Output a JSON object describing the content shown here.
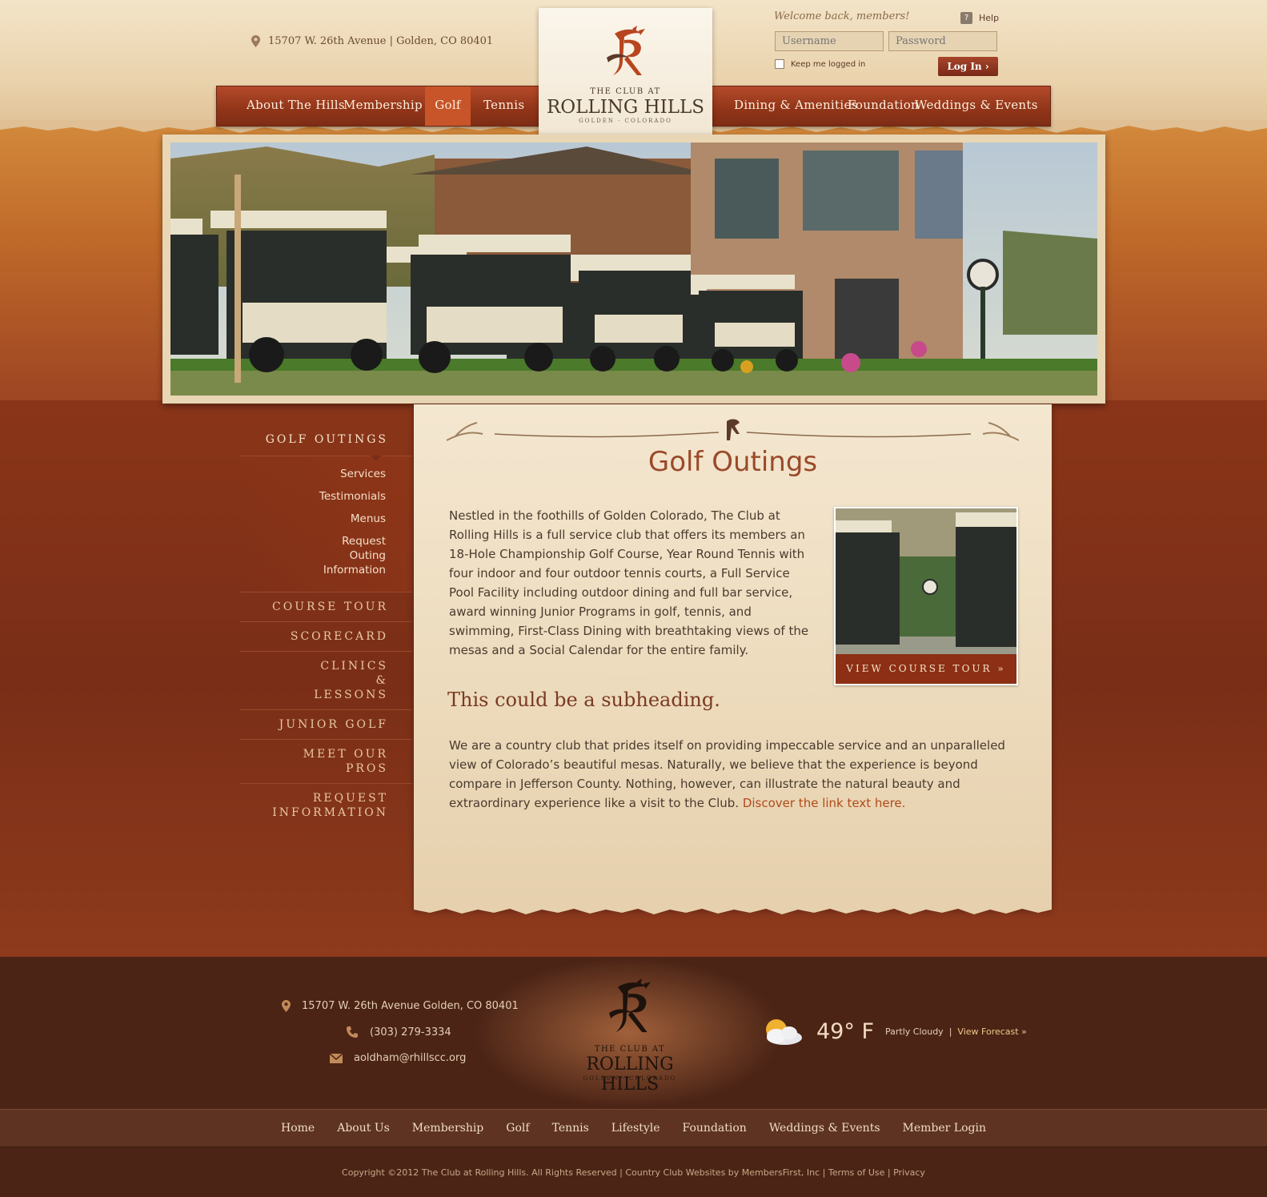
{
  "header": {
    "address": "15707 W. 26th Avenue  |  Golden, CO 80401",
    "welcome": "Welcome back, members!",
    "help": "Help",
    "username_placeholder": "Username",
    "password_placeholder": "Password",
    "keep_logged_in": "Keep me logged in",
    "login_button": "Log In"
  },
  "logo": {
    "small": "THE CLUB AT",
    "big": "ROLLING HILLS",
    "location": "GOLDEN · COLORADO"
  },
  "nav": {
    "left": [
      "About The Hills",
      "Membership",
      "Golf",
      "Tennis"
    ],
    "right": [
      "Dining & Amenities",
      "Foundation",
      "Weddings & Events"
    ],
    "active": "Golf"
  },
  "sidebar": {
    "heading": "GOLF OUTINGS",
    "subitems": [
      "Services",
      "Testimonials",
      "Menus",
      "Request Outing Information"
    ],
    "items": [
      "COURSE TOUR",
      "SCORECARD",
      "CLINICS & LESSONS",
      "JUNIOR GOLF",
      "MEET OUR PROS",
      "REQUEST INFORMATION"
    ]
  },
  "content": {
    "title": "Golf Outings",
    "intro": "Nestled in the foothills of Golden Colorado, The Club at Rolling Hills is a full service club that offers its members an 18-Hole Championship Golf Course, Year Round Tennis with four indoor and four outdoor tennis courts, a Full Service Pool Facility including outdoor dining and full bar service, award winning Junior Programs in golf, tennis, and swimming, First-Class Dining with breathtaking views of the mesas and a Social Calendar for the entire family.",
    "tour_button": "VIEW COURSE TOUR »",
    "subheading": "This could be a subheading.",
    "paragraph": "We are a country club that prides itself on providing impeccable service and an unparalleled view of Colorado’s beautiful mesas.  Naturally, we believe that the experience is beyond compare in Jefferson County.  Nothing, however, can illustrate the natural beauty and extraordinary experience like a visit to the Club. ",
    "link_text": "Discover the link text here."
  },
  "footer": {
    "address": "15707 W. 26th Avenue  Golden, CO 80401",
    "phone": "(303) 279-3334",
    "email": "aoldham@rhillscc.org",
    "temperature": "49° F",
    "condition": "Partly Cloudy",
    "separator": "|",
    "forecast_link": "View Forecast »",
    "nav": [
      "Home",
      "About Us",
      "Membership",
      "Golf",
      "Tennis",
      "Lifestyle",
      "Foundation",
      "Weddings & Events",
      "Member Login"
    ],
    "copyright": "Copyright ©2012 The Club at Rolling Hills. All Rights Reserved | Country Club Websites by MembersFirst, Inc | Terms of Use | Privacy"
  },
  "colors": {
    "accent": "#8c2f14",
    "nav_active": "#c8552a",
    "link": "#b04a1a",
    "footer_bg": "#4b2416"
  }
}
